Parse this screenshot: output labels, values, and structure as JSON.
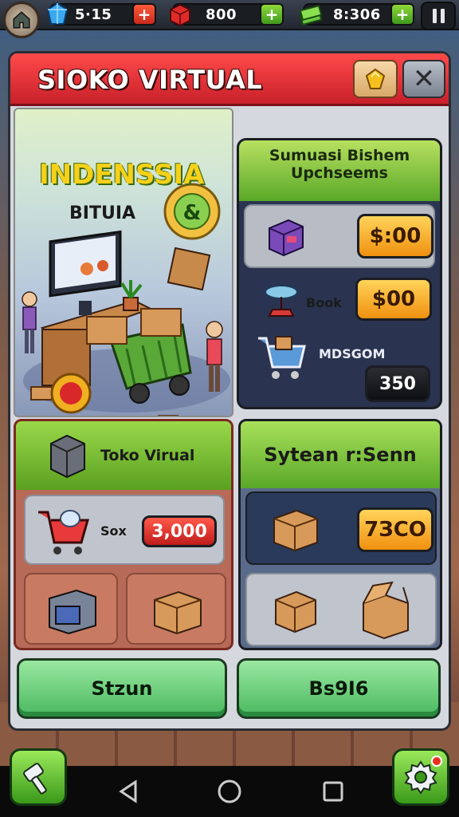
{
  "resources": {
    "gems": "5·15",
    "blocks": "800",
    "cash": "8:306"
  },
  "icons": {
    "home": "house-icon",
    "gems": "blue-gem-icon",
    "blocks": "red-block-icon",
    "cash": "cash-stack-icon",
    "pause": "pause-icon",
    "close": "close-icon",
    "gem_badge": "gold-gem-icon",
    "hammer": "hammer-icon",
    "settings": "gear-icon"
  },
  "panel": {
    "title": "SIOKO VIRTUAL",
    "close_label": "✕"
  },
  "hero": {
    "title": "INDENSSIA",
    "subtitle": "BITUIA"
  },
  "offers": {
    "header_line1": "Sumuasi Bishem",
    "header_line2": "Upchseems",
    "items": [
      {
        "label": "",
        "price": "$:00",
        "style": "orange"
      },
      {
        "label": "Book",
        "price": "$00",
        "style": "orange"
      },
      {
        "label": "MDSGOM",
        "price": "350",
        "style": "dark"
      }
    ]
  },
  "card_left": {
    "header": "Toko Virual",
    "item_label": "Sox",
    "item_price": "3,000"
  },
  "card_right": {
    "header": "Sytean r:Senn",
    "item_price": "7ЗСО"
  },
  "buttons": {
    "left": "Stzun",
    "right": "Bs9I6"
  },
  "colors": {
    "title_red": "#e0283a",
    "accent_green": "#5aa828",
    "price_orange": "#f09010"
  }
}
